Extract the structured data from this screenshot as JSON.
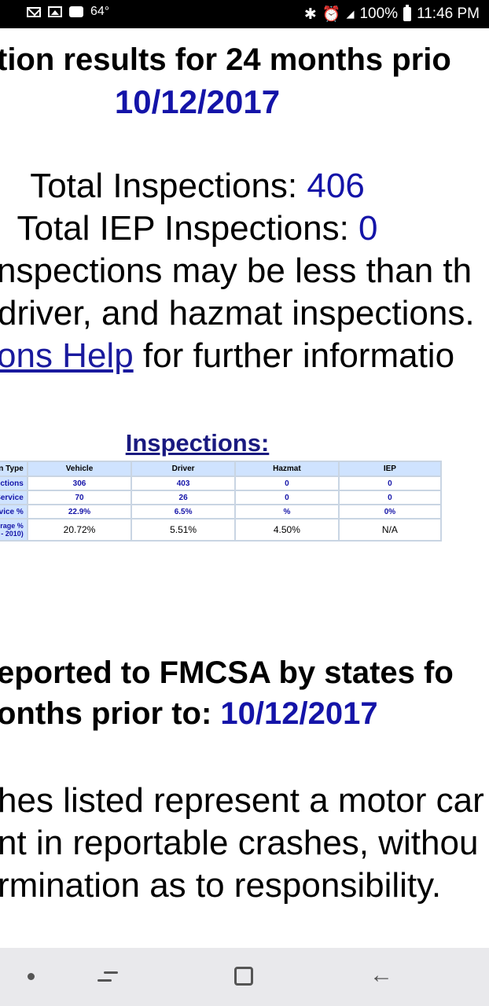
{
  "status_bar": {
    "temperature": "64°",
    "battery": "100%",
    "time": "11:46 PM",
    "network": "LTE"
  },
  "section1": {
    "heading": "tion results for 24 months prio",
    "date": "10/12/2017",
    "total_label": "Total Inspections: ",
    "total_value": "406",
    "iep_label": "Total IEP Inspections: ",
    "iep_value": "0",
    "note_line1": "nspections may be less than th",
    "note_line2": "driver, and hazmat inspections.",
    "help_link": "ons Help",
    "help_rest": " for further informatio"
  },
  "inspections_table": {
    "title": "Inspections:",
    "headers": [
      "on Type",
      "Vehicle",
      "Driver",
      "Hazmat",
      "IEP"
    ],
    "rows": [
      [
        "ections",
        "306",
        "403",
        "0",
        "0"
      ],
      [
        "Service",
        "70",
        "26",
        "0",
        "0"
      ],
      [
        "rvice %",
        "22.9%",
        "6.5%",
        "%",
        "0%"
      ],
      [
        "erage %\n- 2010)",
        "20.72%",
        "5.51%",
        "4.50%",
        "N/A"
      ]
    ]
  },
  "section2": {
    "heading_line1": "eported to FMCSA by states fo",
    "heading_line2": "onths prior to: ",
    "date": "10/12/2017",
    "para_line1": "hes listed represent a motor car",
    "para_line2": "nt in reportable crashes, withou",
    "para_line3": "rmination as to responsibility."
  },
  "colors": {
    "link_blue": "#1414a8",
    "table_header_bg": "#cfe3ff",
    "nav_bg": "#e9e9ec"
  }
}
